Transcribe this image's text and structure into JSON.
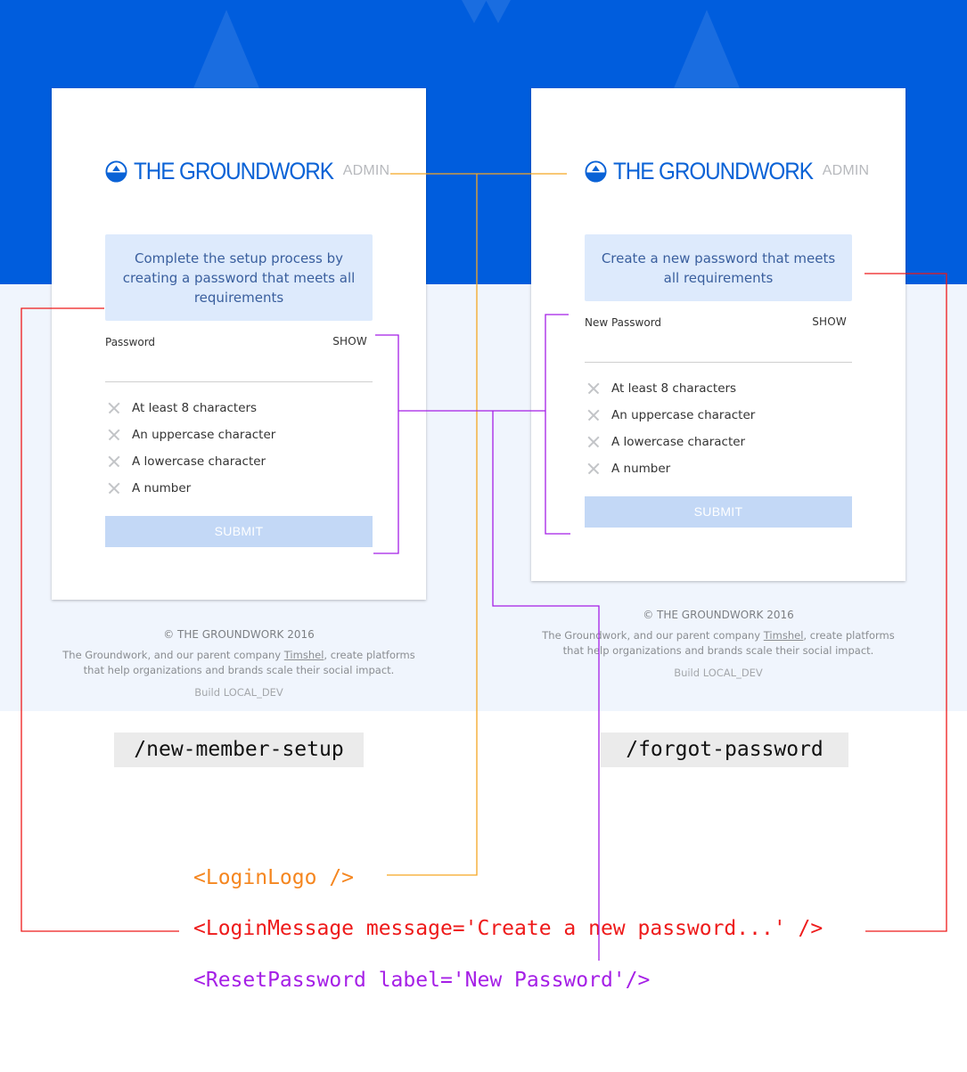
{
  "colors": {
    "brand_blue": "#005ddd",
    "logo_blue": "#0a62d6",
    "message_bg": "#ddeafc",
    "submit_disabled": "#c3d8f6",
    "logo_connector": "#f5a623",
    "message_connector": "#ee1a1a",
    "reset_connector": "#a51fe6"
  },
  "screens": [
    {
      "logo": {
        "icon": "groundwork-logo-icon",
        "title": "THE GROUNDWORK",
        "suffix": "ADMIN"
      },
      "message": "Complete the setup process by creating a password that meets all requirements",
      "password": {
        "label": "Password",
        "toggle": "SHOW",
        "value": ""
      },
      "requirements": [
        {
          "icon": "x-icon",
          "text": "At least 8 characters"
        },
        {
          "icon": "x-icon",
          "text": "An uppercase character"
        },
        {
          "icon": "x-icon",
          "text": "A lowercase character"
        },
        {
          "icon": "x-icon",
          "text": "A number"
        }
      ],
      "submit": "SUBMIT",
      "footer": {
        "copyright": "© THE GROUNDWORK 2016",
        "blurb_before": "The Groundwork, and our parent company ",
        "blurb_link": "Timshel",
        "blurb_after": ", create platforms that help organizations and brands scale their social impact.",
        "build": "Build LOCAL_DEV"
      },
      "route": "/new-member-setup"
    },
    {
      "logo": {
        "icon": "groundwork-logo-icon",
        "title": "THE GROUNDWORK",
        "suffix": "ADMIN"
      },
      "message": "Create a new password that meets all requirements",
      "password": {
        "label": "New Password",
        "toggle": "SHOW",
        "value": ""
      },
      "requirements": [
        {
          "icon": "x-icon",
          "text": "At least 8 characters"
        },
        {
          "icon": "x-icon",
          "text": "An uppercase character"
        },
        {
          "icon": "x-icon",
          "text": "A lowercase character"
        },
        {
          "icon": "x-icon",
          "text": "A number"
        }
      ],
      "submit": "SUBMIT",
      "footer": {
        "copyright": "© THE GROUNDWORK 2016",
        "blurb_before": "The Groundwork, and our parent company ",
        "blurb_link": "Timshel",
        "blurb_after": ", create platforms that help organizations and brands scale their social impact.",
        "build": "Build LOCAL_DEV"
      },
      "route": "/forgot-password"
    }
  ],
  "components": [
    {
      "name": "LoginLogo",
      "code": "<LoginLogo />"
    },
    {
      "name": "LoginMessage",
      "code": "<LoginMessage message='Create a new password...' />"
    },
    {
      "name": "ResetPassword",
      "code": "<ResetPassword label='New Password'/>"
    }
  ]
}
